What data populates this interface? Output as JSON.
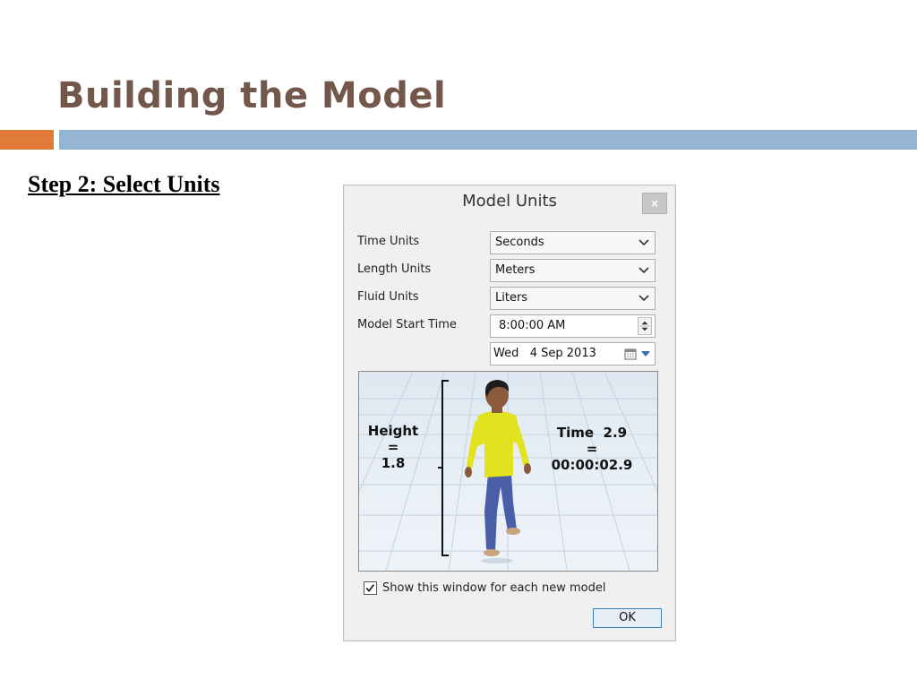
{
  "slide": {
    "title": "Building the Model",
    "step_heading": "Step 2: Select Units",
    "accent_colors": {
      "title": "#73574a",
      "orange_bar": "#e07b39",
      "blue_bar": "#94b6d2"
    }
  },
  "dialog": {
    "title": "Model Units",
    "close_label": "×",
    "fields": {
      "time_units": {
        "label": "Time Units",
        "value": "Seconds"
      },
      "length_units": {
        "label": "Length Units",
        "value": "Meters"
      },
      "fluid_units": {
        "label": "Fluid Units",
        "value": "Liters"
      },
      "start_time": {
        "label": "Model Start Time",
        "value": "8:00:00 AM"
      },
      "start_date": {
        "value": "Wed   4 Sep 2013"
      }
    },
    "preview": {
      "height_label": {
        "line1": "Height",
        "line2": "=",
        "line3": "1.8"
      },
      "time_label": {
        "line1": "Time  2.9",
        "line2": "=",
        "line3": "00:00:02.9"
      }
    },
    "show_each_new_model": {
      "label": "Show this window for each new model",
      "checked": true
    },
    "ok_label": "OK"
  }
}
